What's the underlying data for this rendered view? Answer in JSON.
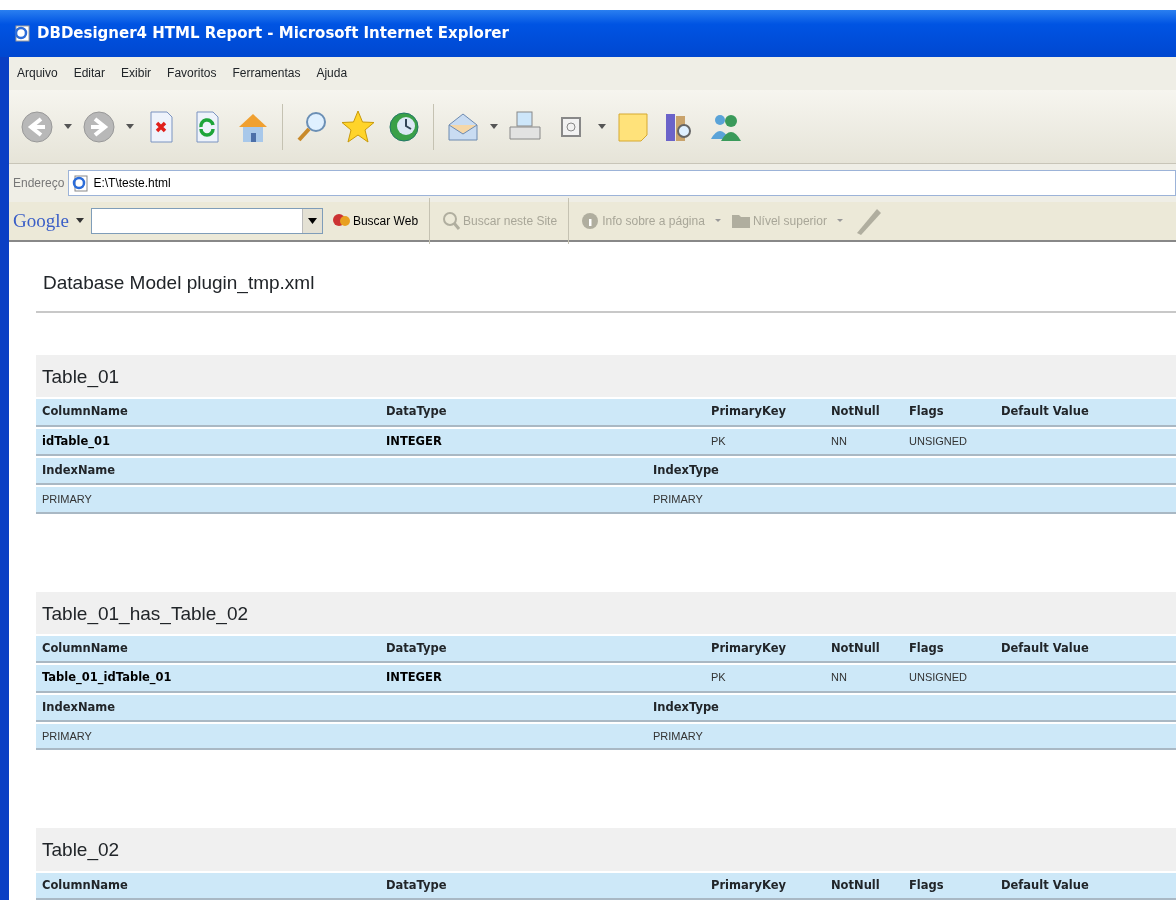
{
  "window": {
    "title": "DBDesigner4 HTML Report - Microsoft Internet Explorer"
  },
  "menu": [
    "Arquivo",
    "Editar",
    "Exibir",
    "Favoritos",
    "Ferramentas",
    "Ajuda"
  ],
  "nav_buttons": [
    {
      "kind": "back",
      "disabled": true
    },
    {
      "kind": "forward",
      "disabled": true
    }
  ],
  "address": {
    "label": "Endereço",
    "value": "E:\\T\\teste.html"
  },
  "google_toolbar": {
    "logo": "Google",
    "buttons": [
      {
        "label": "Buscar Web",
        "disabled": false,
        "dropdown": false
      },
      {
        "label": "Buscar neste Site",
        "disabled": true,
        "dropdown": false
      },
      {
        "label": "Info sobre a página",
        "disabled": true,
        "dropdown": true
      },
      {
        "label": "Nível superior",
        "disabled": true,
        "dropdown": true
      }
    ]
  },
  "page": {
    "heading": "Database Model plugin_tmp.xml",
    "tables": [
      {
        "name": "Table_01",
        "columns": [
          "ColumnName",
          "DataType",
          "PrimaryKey",
          "NotNull",
          "Flags",
          "Default Value"
        ],
        "rows": [
          [
            "idTable_01",
            "INTEGER",
            "PK",
            "NN",
            "UNSIGNED",
            ""
          ]
        ],
        "index_columns": [
          "IndexName",
          "IndexType"
        ],
        "index_rows": [
          [
            "PRIMARY",
            "PRIMARY"
          ]
        ]
      },
      {
        "name": "Table_01_has_Table_02",
        "columns": [
          "ColumnName",
          "DataType",
          "PrimaryKey",
          "NotNull",
          "Flags",
          "Default Value"
        ],
        "rows": [
          [
            "Table_01_idTable_01",
            "INTEGER",
            "PK",
            "NN",
            "UNSIGNED",
            ""
          ]
        ],
        "index_columns": [
          "IndexName",
          "IndexType"
        ],
        "index_rows": [
          [
            "PRIMARY",
            "PRIMARY"
          ]
        ]
      },
      {
        "name": "Table_02",
        "columns": [
          "ColumnName",
          "DataType",
          "PrimaryKey",
          "NotNull",
          "Flags",
          "Default Value"
        ]
      }
    ]
  }
}
